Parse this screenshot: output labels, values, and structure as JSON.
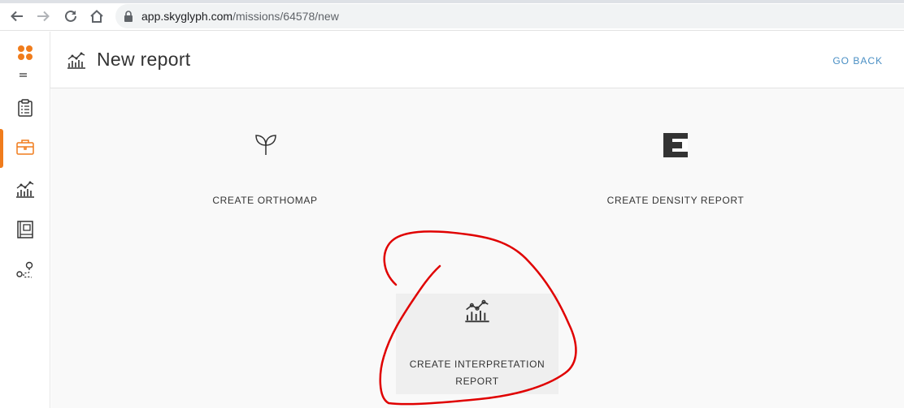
{
  "browser": {
    "url_host": "app.skyglyph.com",
    "url_path": "/missions/64578/new",
    "icons": [
      "back-arrow-icon",
      "forward-arrow-icon",
      "reload-icon",
      "home-icon",
      "lock-icon"
    ]
  },
  "sidebar": {
    "items": [
      {
        "icon": "clipboard-icon"
      },
      {
        "icon": "briefcase-icon",
        "active": true
      },
      {
        "icon": "chart-icon"
      },
      {
        "icon": "book-icon"
      },
      {
        "icon": "route-icon"
      }
    ]
  },
  "header": {
    "title": "New report",
    "go_back_label": "GO BACK"
  },
  "options": {
    "orthomap_label": "CREATE ORTHOMAP",
    "density_label": "CREATE DENSITY REPORT",
    "interpretation_label_line1": "CREATE INTERPRETATION",
    "interpretation_label_line2": "REPORT"
  },
  "colors": {
    "accent": "#f07c1c",
    "link": "#4a8fc4",
    "annotation": "#e00000"
  }
}
